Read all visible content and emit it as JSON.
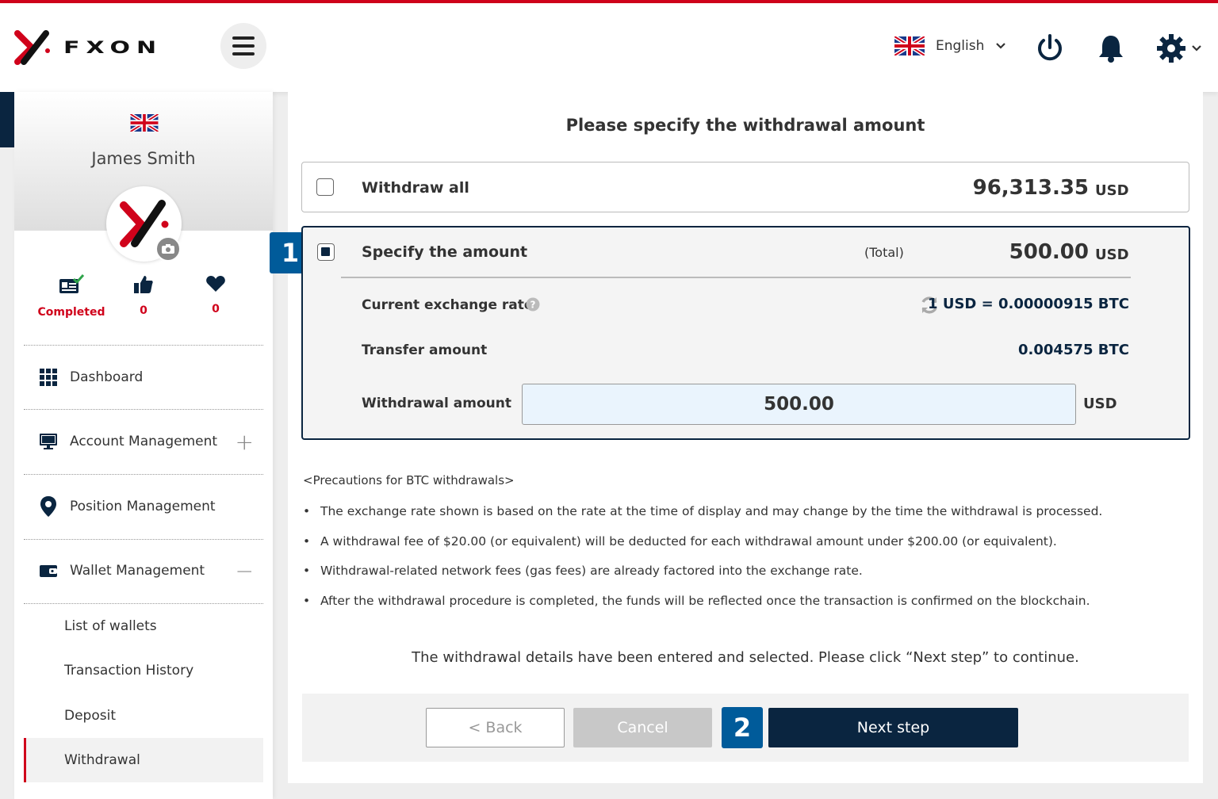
{
  "header": {
    "brand": "FXON",
    "language": "English"
  },
  "profile": {
    "name": "James Smith",
    "stats": [
      {
        "label": "Completed"
      },
      {
        "label": "0"
      },
      {
        "label": "0"
      }
    ]
  },
  "sidebar": {
    "items": [
      {
        "label": "Dashboard"
      },
      {
        "label": "Account Management",
        "toggle": "+"
      },
      {
        "label": "Position Management"
      },
      {
        "label": "Wallet Management",
        "toggle": "−"
      }
    ],
    "sub_items": [
      {
        "label": "List of wallets"
      },
      {
        "label": "Transaction History"
      },
      {
        "label": "Deposit"
      },
      {
        "label": "Withdrawal"
      }
    ]
  },
  "main": {
    "title": "Please specify the withdrawal amount",
    "withdraw_all": {
      "label": "Withdraw all",
      "amount": "96,313.35",
      "unit": "USD"
    },
    "specify": {
      "label": "Specify the amount",
      "total_label": "(Total)",
      "amount": "500.00",
      "unit": "USD",
      "rate_label": "Current exchange rate",
      "rate_value": "1 USD = 0.00000915 BTC",
      "transfer_label": "Transfer amount",
      "transfer_value": "0.004575 BTC",
      "withdrawal_label": "Withdrawal amount",
      "withdrawal_value": "500.00",
      "withdrawal_unit": "USD"
    },
    "badges": [
      "1",
      "2"
    ],
    "precautions_title": "<Precautions for BTC withdrawals>",
    "precautions": [
      "The exchange rate shown is based on the rate at the time of display and may change by the time the withdrawal is processed.",
      "A withdrawal fee of $20.00 (or equivalent) will be deducted for each withdrawal amount under $200.00 (or equivalent).",
      "Withdrawal-related network fees (gas fees) are already factored into the exchange rate.",
      "After the withdrawal procedure is completed, the funds will be reflected once the transaction is confirmed on the blockchain."
    ],
    "notice": "The withdrawal details have been entered and selected. Please click “Next step” to continue.",
    "buttons": {
      "back": "< Back",
      "cancel": "Cancel",
      "next": "Next step"
    }
  },
  "colors": {
    "accent_red": "#d0021b",
    "navy": "#0a2540",
    "badge_blue": "#005b9a"
  },
  "icons": [
    "hamburger-icon",
    "uk-flag-icon",
    "power-icon",
    "bell-icon",
    "gear-icon",
    "camera-icon",
    "id-card-check-icon",
    "thumbs-up-icon",
    "heart-icon",
    "grid-icon",
    "monitor-icon",
    "location-pin-icon",
    "wallet-icon",
    "help-icon",
    "refresh-icon"
  ]
}
